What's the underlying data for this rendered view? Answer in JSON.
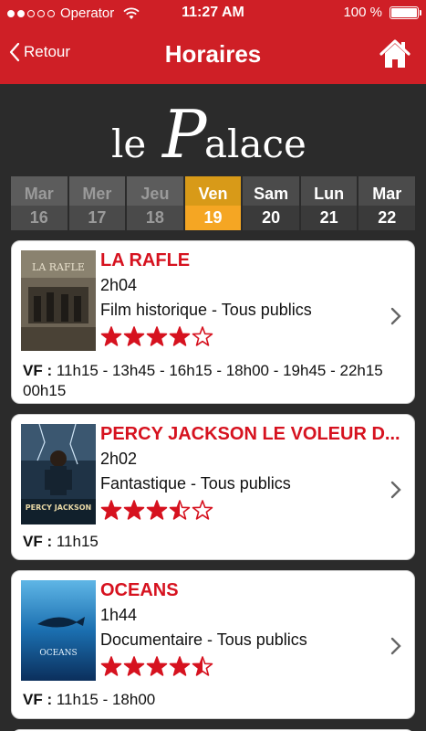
{
  "status": {
    "carrier": "Operator",
    "time": "11:27 AM",
    "battery": "100 %",
    "battery_level": 1.0,
    "signal_full": 2,
    "signal_total": 5
  },
  "nav": {
    "back_label": "Retour",
    "title": "Horaires"
  },
  "logo_text": "le Palace",
  "days": [
    {
      "name": "Mar",
      "num": "16",
      "state": "past"
    },
    {
      "name": "Mer",
      "num": "17",
      "state": "past"
    },
    {
      "name": "Jeu",
      "num": "18",
      "state": "past"
    },
    {
      "name": "Ven",
      "num": "19",
      "state": "selected"
    },
    {
      "name": "Sam",
      "num": "20",
      "state": "future"
    },
    {
      "name": "Lun",
      "num": "21",
      "state": "future"
    },
    {
      "name": "Mar",
      "num": "22",
      "state": "future"
    }
  ],
  "films": [
    {
      "title": "LA RAFLE",
      "duration": "2h04",
      "genre": "Film historique - Tous publics",
      "rating": 4,
      "lang": "VF :",
      "times": "11h15 - 13h45 - 16h15 - 18h00 - 19h45 - 22h15",
      "times2": "00h15",
      "poster_text": "LA RAFLE"
    },
    {
      "title": "PERCY JACKSON LE VOLEUR D...",
      "duration": "2h02",
      "genre": "Fantastique - Tous publics",
      "rating": 3.5,
      "lang": "VF :",
      "times": "11h15",
      "times2": "",
      "poster_text": "PERCY JACKSON"
    },
    {
      "title": "OCEANS",
      "duration": "1h44",
      "genre": "Documentaire - Tous publics",
      "rating": 4.5,
      "lang": "VF :",
      "times": "11h15 - 18h00",
      "times2": "",
      "poster_text": "OCEANS"
    }
  ],
  "colors": {
    "brand_red": "#cf1f26",
    "title_red": "#d6121f",
    "selected_day": "#f5a623",
    "background": "#2b2b2b"
  }
}
